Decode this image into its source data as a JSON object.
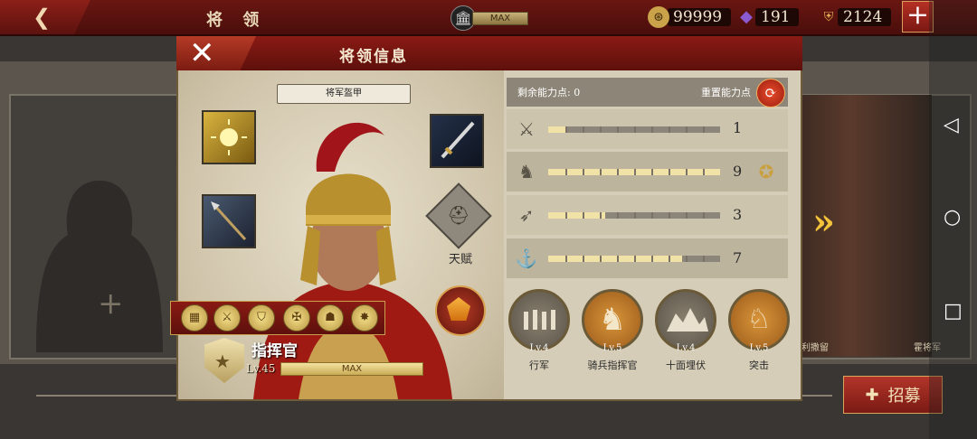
{
  "topbar": {
    "title": "将 领",
    "bank_label": "MAX",
    "resources": [
      {
        "name": "coins",
        "value": "99999",
        "icon": "coin-icon",
        "color": "#c9a24a"
      },
      {
        "name": "gems",
        "value": "191",
        "icon": "crystal-icon",
        "color": "#6d3bb0"
      },
      {
        "name": "population",
        "value": "2124",
        "icon": "helmet-icon",
        "color": "#c9a24a"
      }
    ]
  },
  "dialog": {
    "title": "将领信息",
    "armor_label": "将军盔甲",
    "talent_label": "天赋",
    "rank": {
      "name": "指挥官",
      "level": "Lv.45",
      "bar_label": "MAX",
      "progress": 1.0
    },
    "points": {
      "label": "剩余能力点: 0",
      "reset_label": "重置能力点"
    },
    "stats": [
      {
        "icon": "sword-icon",
        "value": "1",
        "fill": 0.1
      },
      {
        "icon": "horse-icon",
        "value": "9",
        "fill": 1.0
      },
      {
        "icon": "bow-icon",
        "value": "3",
        "fill": 0.33
      },
      {
        "icon": "anchor-icon",
        "value": "7",
        "fill": 0.78
      }
    ],
    "skills": [
      {
        "level": "Lv.4",
        "name": "行军"
      },
      {
        "level": "Lv.5",
        "name": "骑兵指挥官"
      },
      {
        "level": "Lv.4",
        "name": "十面埋伏"
      },
      {
        "level": "Lv.5",
        "name": "突击"
      }
    ]
  },
  "side": {
    "recruit_label": "招募",
    "names": [
      "利撒留",
      "霍将军"
    ]
  },
  "colors": {
    "accent": "#8a1a14",
    "gold": "#c9a24a",
    "panel": "#d6cdb8"
  }
}
